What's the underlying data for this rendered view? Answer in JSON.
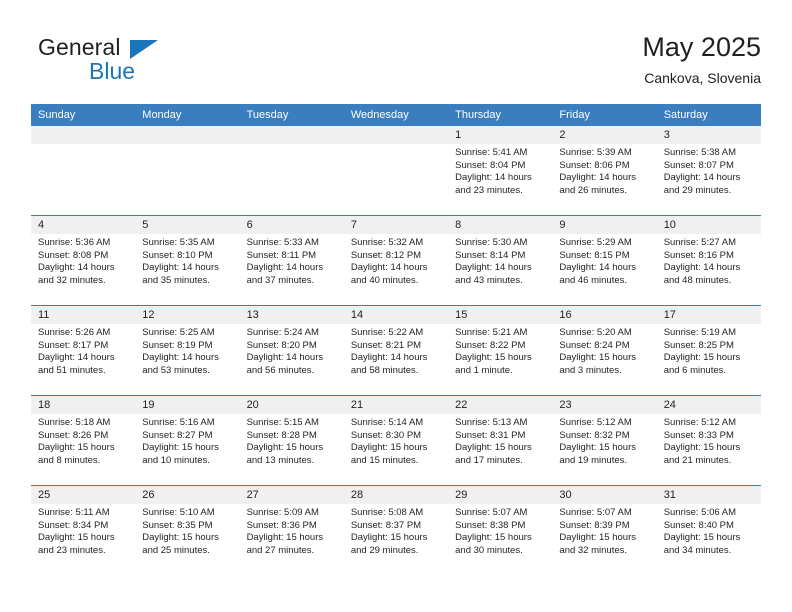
{
  "logo": {
    "word_top": "General",
    "word_bottom": "Blue",
    "triangle_icon": "blue-triangle-icon",
    "accent_color": "#1b75bb"
  },
  "header": {
    "title": "May 2025",
    "subtitle": "Cankova, Slovenia"
  },
  "calendar": {
    "header_color": "#3a7ebf",
    "daynum_band_color": "#f0f0f0",
    "day_names": [
      "Sunday",
      "Monday",
      "Tuesday",
      "Wednesday",
      "Thursday",
      "Friday",
      "Saturday"
    ],
    "weeks": [
      [
        {
          "day": "",
          "empty": true
        },
        {
          "day": "",
          "empty": true
        },
        {
          "day": "",
          "empty": true
        },
        {
          "day": "",
          "empty": true
        },
        {
          "day": "1",
          "sunrise": "Sunrise: 5:41 AM",
          "sunset": "Sunset: 8:04 PM",
          "daylight": "Daylight: 14 hours and 23 minutes."
        },
        {
          "day": "2",
          "sunrise": "Sunrise: 5:39 AM",
          "sunset": "Sunset: 8:06 PM",
          "daylight": "Daylight: 14 hours and 26 minutes."
        },
        {
          "day": "3",
          "sunrise": "Sunrise: 5:38 AM",
          "sunset": "Sunset: 8:07 PM",
          "daylight": "Daylight: 14 hours and 29 minutes."
        }
      ],
      [
        {
          "day": "4",
          "sunrise": "Sunrise: 5:36 AM",
          "sunset": "Sunset: 8:08 PM",
          "daylight": "Daylight: 14 hours and 32 minutes."
        },
        {
          "day": "5",
          "sunrise": "Sunrise: 5:35 AM",
          "sunset": "Sunset: 8:10 PM",
          "daylight": "Daylight: 14 hours and 35 minutes."
        },
        {
          "day": "6",
          "sunrise": "Sunrise: 5:33 AM",
          "sunset": "Sunset: 8:11 PM",
          "daylight": "Daylight: 14 hours and 37 minutes."
        },
        {
          "day": "7",
          "sunrise": "Sunrise: 5:32 AM",
          "sunset": "Sunset: 8:12 PM",
          "daylight": "Daylight: 14 hours and 40 minutes."
        },
        {
          "day": "8",
          "sunrise": "Sunrise: 5:30 AM",
          "sunset": "Sunset: 8:14 PM",
          "daylight": "Daylight: 14 hours and 43 minutes."
        },
        {
          "day": "9",
          "sunrise": "Sunrise: 5:29 AM",
          "sunset": "Sunset: 8:15 PM",
          "daylight": "Daylight: 14 hours and 46 minutes."
        },
        {
          "day": "10",
          "sunrise": "Sunrise: 5:27 AM",
          "sunset": "Sunset: 8:16 PM",
          "daylight": "Daylight: 14 hours and 48 minutes."
        }
      ],
      [
        {
          "day": "11",
          "sunrise": "Sunrise: 5:26 AM",
          "sunset": "Sunset: 8:17 PM",
          "daylight": "Daylight: 14 hours and 51 minutes."
        },
        {
          "day": "12",
          "sunrise": "Sunrise: 5:25 AM",
          "sunset": "Sunset: 8:19 PM",
          "daylight": "Daylight: 14 hours and 53 minutes."
        },
        {
          "day": "13",
          "sunrise": "Sunrise: 5:24 AM",
          "sunset": "Sunset: 8:20 PM",
          "daylight": "Daylight: 14 hours and 56 minutes."
        },
        {
          "day": "14",
          "sunrise": "Sunrise: 5:22 AM",
          "sunset": "Sunset: 8:21 PM",
          "daylight": "Daylight: 14 hours and 58 minutes."
        },
        {
          "day": "15",
          "sunrise": "Sunrise: 5:21 AM",
          "sunset": "Sunset: 8:22 PM",
          "daylight": "Daylight: 15 hours and 1 minute."
        },
        {
          "day": "16",
          "sunrise": "Sunrise: 5:20 AM",
          "sunset": "Sunset: 8:24 PM",
          "daylight": "Daylight: 15 hours and 3 minutes."
        },
        {
          "day": "17",
          "sunrise": "Sunrise: 5:19 AM",
          "sunset": "Sunset: 8:25 PM",
          "daylight": "Daylight: 15 hours and 6 minutes."
        }
      ],
      [
        {
          "day": "18",
          "sunrise": "Sunrise: 5:18 AM",
          "sunset": "Sunset: 8:26 PM",
          "daylight": "Daylight: 15 hours and 8 minutes."
        },
        {
          "day": "19",
          "sunrise": "Sunrise: 5:16 AM",
          "sunset": "Sunset: 8:27 PM",
          "daylight": "Daylight: 15 hours and 10 minutes."
        },
        {
          "day": "20",
          "sunrise": "Sunrise: 5:15 AM",
          "sunset": "Sunset: 8:28 PM",
          "daylight": "Daylight: 15 hours and 13 minutes."
        },
        {
          "day": "21",
          "sunrise": "Sunrise: 5:14 AM",
          "sunset": "Sunset: 8:30 PM",
          "daylight": "Daylight: 15 hours and 15 minutes."
        },
        {
          "day": "22",
          "sunrise": "Sunrise: 5:13 AM",
          "sunset": "Sunset: 8:31 PM",
          "daylight": "Daylight: 15 hours and 17 minutes."
        },
        {
          "day": "23",
          "sunrise": "Sunrise: 5:12 AM",
          "sunset": "Sunset: 8:32 PM",
          "daylight": "Daylight: 15 hours and 19 minutes."
        },
        {
          "day": "24",
          "sunrise": "Sunrise: 5:12 AM",
          "sunset": "Sunset: 8:33 PM",
          "daylight": "Daylight: 15 hours and 21 minutes."
        }
      ],
      [
        {
          "day": "25",
          "sunrise": "Sunrise: 5:11 AM",
          "sunset": "Sunset: 8:34 PM",
          "daylight": "Daylight: 15 hours and 23 minutes."
        },
        {
          "day": "26",
          "sunrise": "Sunrise: 5:10 AM",
          "sunset": "Sunset: 8:35 PM",
          "daylight": "Daylight: 15 hours and 25 minutes."
        },
        {
          "day": "27",
          "sunrise": "Sunrise: 5:09 AM",
          "sunset": "Sunset: 8:36 PM",
          "daylight": "Daylight: 15 hours and 27 minutes."
        },
        {
          "day": "28",
          "sunrise": "Sunrise: 5:08 AM",
          "sunset": "Sunset: 8:37 PM",
          "daylight": "Daylight: 15 hours and 29 minutes."
        },
        {
          "day": "29",
          "sunrise": "Sunrise: 5:07 AM",
          "sunset": "Sunset: 8:38 PM",
          "daylight": "Daylight: 15 hours and 30 minutes."
        },
        {
          "day": "30",
          "sunrise": "Sunrise: 5:07 AM",
          "sunset": "Sunset: 8:39 PM",
          "daylight": "Daylight: 15 hours and 32 minutes."
        },
        {
          "day": "31",
          "sunrise": "Sunrise: 5:06 AM",
          "sunset": "Sunset: 8:40 PM",
          "daylight": "Daylight: 15 hours and 34 minutes."
        }
      ]
    ]
  }
}
